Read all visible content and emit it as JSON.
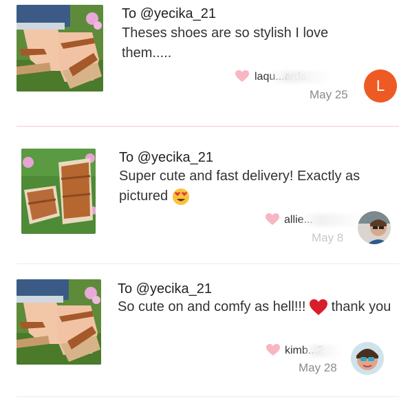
{
  "reviews": [
    {
      "to": "To @yecika_21",
      "message": "Theses shoes are so stylish I love them.....",
      "username": "laqu...ards",
      "date": "May 25",
      "avatar_letter": "L",
      "avatar_color": "#ee5a24",
      "photo": "sandals-on-feet-photo"
    },
    {
      "to": "To @yecika_21",
      "message": "Super cute and fast delivery! Exactly as pictured",
      "emoji": "heart-eyes-emoji",
      "username": "allie...",
      "date": "May 8",
      "photo": "sandals-pair-photo"
    },
    {
      "to": "To @yecika_21",
      "message_before": "So cute on and comfy as hell!!!",
      "message_after": "thank you",
      "emoji": "red-heart-emoji",
      "username": "kimb...2",
      "date": "May 28",
      "photo": "sandals-on-feet-photo"
    }
  ],
  "colors": {
    "heart": "#f7b6c2",
    "divider": "#f2c9cf",
    "date": "#8a8a8a",
    "accent_orange": "#ee5a24"
  }
}
